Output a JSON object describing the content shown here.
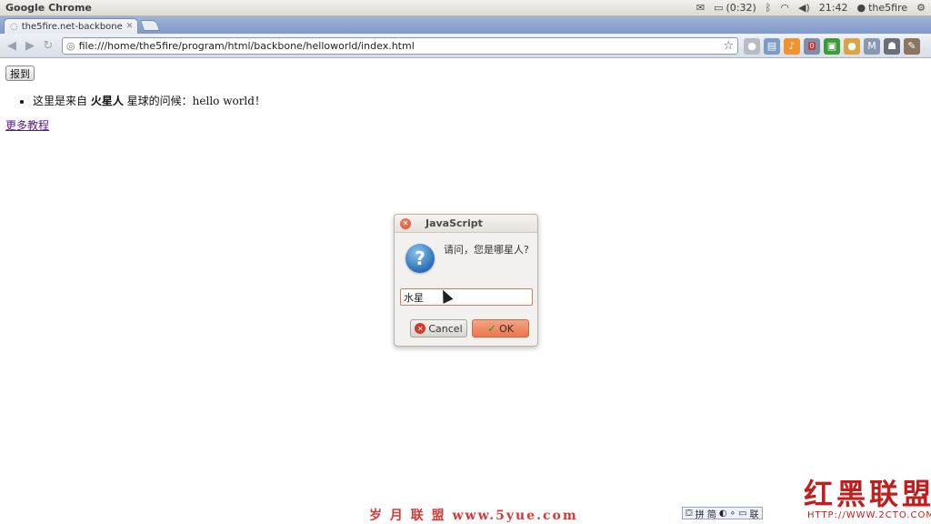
{
  "panel": {
    "app_name": "Google Chrome",
    "battery": "(0:32)",
    "clock": "21:42",
    "user": "the5fire",
    "icons": [
      "mail-icon",
      "battery-icon",
      "bluetooth-icon",
      "wifi-icon",
      "volume-icon",
      "user-icon",
      "settings-gear-icon"
    ]
  },
  "browser": {
    "tab_title": "the5fire.net-backbone",
    "url": "file:///home/the5fire/program/html/backbone/helloworld/index.html",
    "extension_badge": "0"
  },
  "page": {
    "report_button": "报到",
    "greeting_prefix": "这里是来自 ",
    "greeting_planet": "火星人",
    "greeting_suffix": " 星球的问候：hello world！",
    "more_link": "更多教程"
  },
  "dialog": {
    "title": "JavaScript",
    "message": "请问，您是哪星人?",
    "input_value": "水星",
    "cancel_label": "Cancel",
    "ok_label": "OK"
  },
  "watermark": {
    "bottom_text": "岁 月 联 盟   www.5yue.com",
    "brand": "红黑联盟",
    "brand_url": "HTTP://WWW.2CTO.COM"
  },
  "ime": {
    "label": "拼 简",
    "suffix": "联"
  },
  "colors": {
    "dialog_accent": "#e9764e",
    "link_visited": "#551a8b",
    "watermark_red": "#c21e1e"
  }
}
